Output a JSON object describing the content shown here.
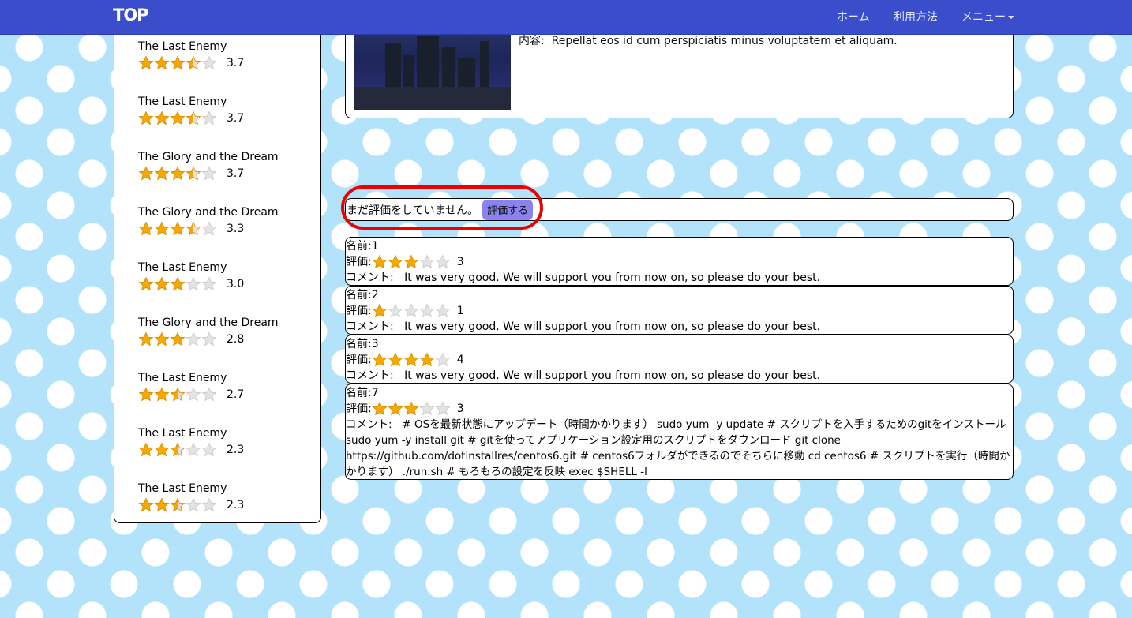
{
  "nav": {
    "brand": "TOP",
    "home": "ホーム",
    "usage": "利用方法",
    "menu": "メニュー"
  },
  "ranking": [
    {
      "title": "The Last Enemy",
      "rating": 3.7,
      "score": "3.7"
    },
    {
      "title": "The Last Enemy",
      "rating": 3.7,
      "score": "3.7"
    },
    {
      "title": "The Glory and the Dream",
      "rating": 3.7,
      "score": "3.7"
    },
    {
      "title": "The Glory and the Dream",
      "rating": 3.3,
      "score": "3.3"
    },
    {
      "title": "The Last Enemy",
      "rating": 3.0,
      "score": "3.0"
    },
    {
      "title": "The Glory and the Dream",
      "rating": 2.8,
      "score": "2.8"
    },
    {
      "title": "The Last Enemy",
      "rating": 2.7,
      "score": "2.7"
    },
    {
      "title": "The Last Enemy",
      "rating": 2.3,
      "score": "2.3"
    },
    {
      "title": "The Last Enemy",
      "rating": 2.3,
      "score": "2.3"
    }
  ],
  "detail": {
    "content_label": "内容:",
    "content_text": "Repellat eos id cum perspiciatis minus voluptatem et aliquam."
  },
  "evaluation": {
    "message": "まだ評価をしていません。",
    "button_label": "評価する"
  },
  "labels": {
    "name": "名前:",
    "rating": "評価:",
    "comment": "コメント:"
  },
  "reviews": [
    {
      "name": "1",
      "rating": 3,
      "score": "3",
      "comment": "It was very good. We will support you from now on, so please do your best."
    },
    {
      "name": "2",
      "rating": 1,
      "score": "1",
      "comment": "It was very good. We will support you from now on, so please do your best."
    },
    {
      "name": "3",
      "rating": 4,
      "score": "4",
      "comment": "It was very good. We will support you from now on, so please do your best."
    },
    {
      "name": "7",
      "rating": 3,
      "score": "3",
      "comment": "# OSを最新状態にアップデート（時間かかります） sudo yum -y update # スクリプトを入手するためのgitをインストール sudo yum -y install git # gitを使ってアプリケーション設定用のスクリプトをダウンロード git clone https://github.com/dotinstallres/centos6.git # centos6フォルダができるのでそちらに移動 cd centos6 # スクリプトを実行（時間かかります） ./run.sh # もろもろの設定を反映 exec $SHELL -l"
    }
  ],
  "colors": {
    "nav": "#3a4ecb",
    "star_fill": "#f6a800",
    "star_empty": "#e3e3e3",
    "highlight": "#e00000",
    "eval_button": "#8a82f0"
  }
}
